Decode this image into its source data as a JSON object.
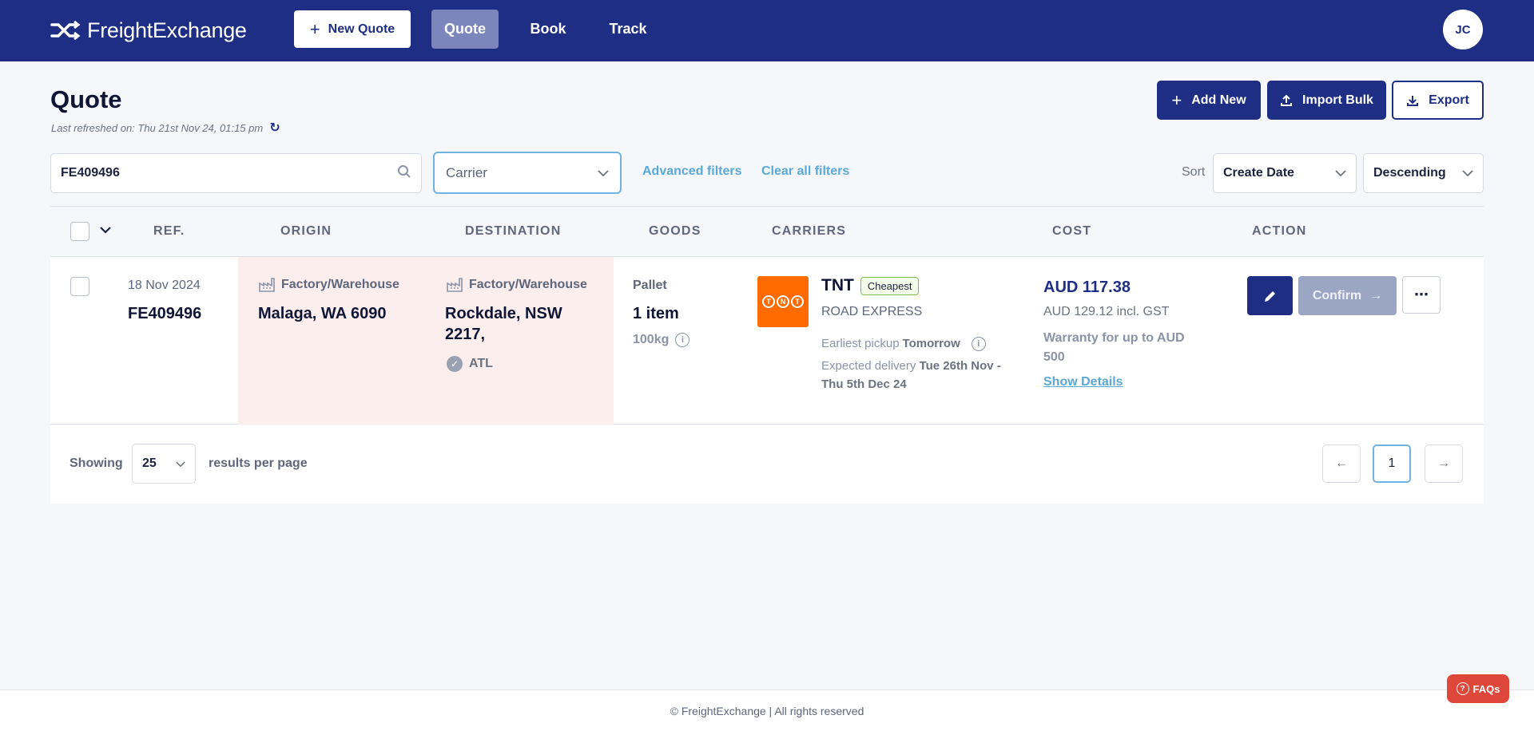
{
  "app": {
    "logo_text": "FreightExchange"
  },
  "nav": {
    "new_quote_label": "New Quote",
    "tabs": [
      {
        "label": "Quote",
        "active": true
      },
      {
        "label": "Book",
        "active": false
      },
      {
        "label": "Track",
        "active": false
      }
    ],
    "avatar_initials": "JC"
  },
  "header": {
    "title": "Quote",
    "last_refreshed": "Last refreshed on: Thu 21st Nov 24, 01:15 pm",
    "buttons": {
      "add_new": "Add New",
      "import_bulk": "Import Bulk",
      "export": "Export"
    }
  },
  "filters": {
    "search_value": "FE409496",
    "carrier_placeholder": "Carrier",
    "advanced_filters": "Advanced filters",
    "clear_all_filters": "Clear all filters",
    "sort_label": "Sort",
    "sort_field": "Create Date",
    "sort_order": "Descending"
  },
  "table": {
    "columns": [
      "REF.",
      "ORIGIN",
      "DESTINATION",
      "GOODS",
      "CARRIERS",
      "COST",
      "ACTION"
    ],
    "rows": [
      {
        "date": "18 Nov 2024",
        "ref": "FE409496",
        "origin_type": "Factory/Warehouse",
        "origin": "Malaga, WA 6090",
        "destination_type": "Factory/Warehouse",
        "destination": "Rockdale, NSW 2217,",
        "atl": "ATL",
        "goods_type": "Pallet",
        "goods_qty": "1 item",
        "goods_weight": "100kg",
        "carrier": "TNT",
        "carrier_badge": "Cheapest",
        "service": "ROAD EXPRESS",
        "pickup_label": "Earliest pickup",
        "pickup_value": "Tomorrow",
        "delivery_label": "Expected delivery",
        "delivery_value": "Tue 26th Nov - Thu 5th Dec 24",
        "cost": "AUD 117.38",
        "cost_gst": "AUD 129.12 incl. GST",
        "warranty": "Warranty for up to AUD 500",
        "show_details": "Show Details",
        "confirm_label": "Confirm"
      }
    ]
  },
  "pagination": {
    "showing_label": "Showing",
    "per_page": "25",
    "results_label": "results per page",
    "current_page": "1"
  },
  "footer": {
    "copyright": "© FreightExchange | All rights reserved",
    "faq_label": "FAQs"
  },
  "colors": {
    "brand": "#1f2e85",
    "accent_link": "#5aa8d8",
    "carrier_brand": "#ff6b00",
    "highlight_row": "#fdeeee",
    "faq": "#e0473b"
  }
}
